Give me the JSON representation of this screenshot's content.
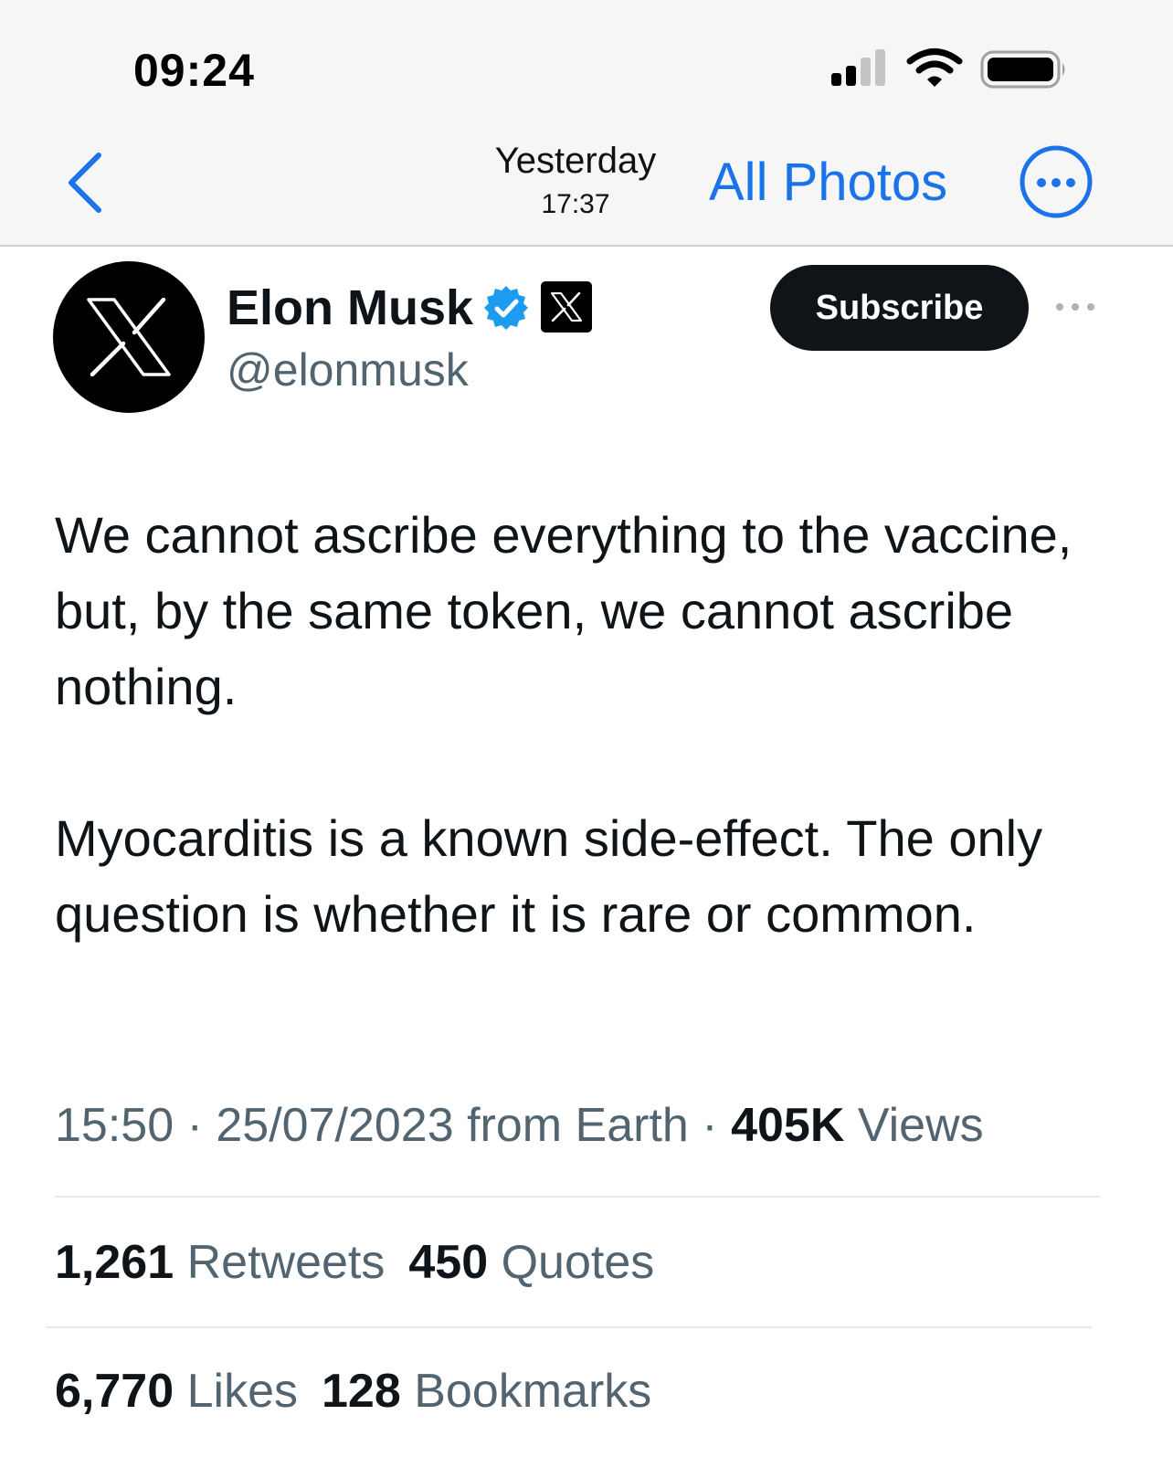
{
  "status_bar": {
    "time": "09:24",
    "icons": [
      "cellular-signal-icon",
      "wifi-icon",
      "battery-icon"
    ]
  },
  "photos_nav": {
    "date": "Yesterday",
    "time": "17:37",
    "all_photos_label": "All Photos",
    "icons": [
      "chevron-left-icon",
      "more-circle-icon"
    ],
    "accent_color": "#1a73e8"
  },
  "tweet": {
    "author": {
      "name": "Elon Musk",
      "handle": "@elonmusk",
      "avatar_icon": "x-logo-icon",
      "verified_icon": "verified-badge-icon",
      "affiliate_icon": "x-affiliate-badge-icon",
      "verified_color": "#1d9bf0"
    },
    "subscribe_label": "Subscribe",
    "more_icon": "more-horizontal-icon",
    "paragraphs": [
      "We cannot ascribe everything to the vaccine, but, by the same token, we cannot ascribe nothing.",
      "Myocarditis is a known side-effect. The only question is whether it is rare or common."
    ],
    "meta": {
      "time": "15:50",
      "separator": "·",
      "date": "25/07/2023",
      "source": "from Earth",
      "views_count": "405K",
      "views_label": "Views"
    },
    "stats": {
      "retweets_count": "1,261",
      "retweets_label": "Retweets",
      "quotes_count": "450",
      "quotes_label": "Quotes",
      "likes_count": "6,770",
      "likes_label": "Likes",
      "bookmarks_count": "128",
      "bookmarks_label": "Bookmarks"
    }
  }
}
